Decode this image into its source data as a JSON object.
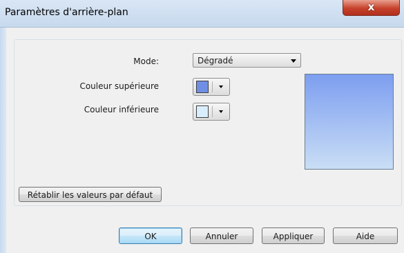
{
  "window": {
    "title": "Paramètres d'arrière-plan",
    "close_label": "x"
  },
  "form": {
    "mode_label": "Mode:",
    "mode_value": "Dégradé",
    "upper_color_label": "Couleur supérieure",
    "upper_color": "#6f8fe6",
    "lower_color_label": "Couleur inférieure",
    "lower_color": "#d9eefc",
    "reset_label": "Rétablir les valeurs par défaut"
  },
  "preview": {
    "gradient_top": "#7d9ef0",
    "gradient_bottom": "#c9def5"
  },
  "buttons": {
    "ok": "OK",
    "cancel": "Annuler",
    "apply": "Appliquer",
    "help": "Aide"
  },
  "icons": {
    "close": "close-icon",
    "dropdown": "chevron-down-icon"
  }
}
